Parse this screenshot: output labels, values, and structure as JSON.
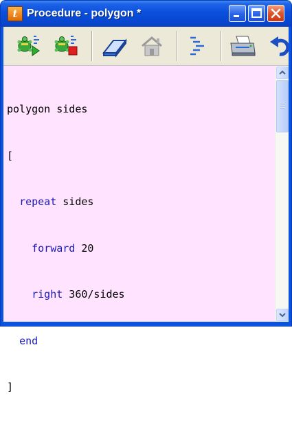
{
  "window": {
    "title": "Procedure - polygon *",
    "app_icon_letter": "t"
  },
  "titlebar_buttons": [
    "minimize-icon",
    "maximize-icon",
    "close-icon"
  ],
  "toolbar": {
    "tools": [
      {
        "name": "run-turtle-icon",
        "color": "#2e9a2e"
      },
      {
        "name": "stop-turtle-icon",
        "color": "#d01818"
      },
      {
        "name": "eraser-icon",
        "color": "#3a5fb0"
      },
      {
        "name": "home-icon",
        "color": "#9a9a9a"
      },
      {
        "name": "format-indent-icon",
        "color": "#2a6ad8"
      },
      {
        "name": "print-icon",
        "color": "#5a6a80"
      },
      {
        "name": "undo-icon",
        "color": "#1d4fc4"
      }
    ]
  },
  "editor": {
    "background": "#ffe3ff",
    "keyword_color": "#1a1ab4",
    "lines": [
      {
        "indent": "",
        "keyword": "",
        "text": "polygon sides"
      },
      {
        "indent": "",
        "keyword": "",
        "text": "["
      },
      {
        "indent": "  ",
        "keyword": "repeat",
        "text": " sides"
      },
      {
        "indent": "    ",
        "keyword": "forward",
        "text": " 20"
      },
      {
        "indent": "    ",
        "keyword": "right",
        "text": " 360/sides"
      },
      {
        "indent": "  ",
        "keyword": "end",
        "text": ""
      },
      {
        "indent": "",
        "keyword": "",
        "text": "]"
      }
    ]
  }
}
